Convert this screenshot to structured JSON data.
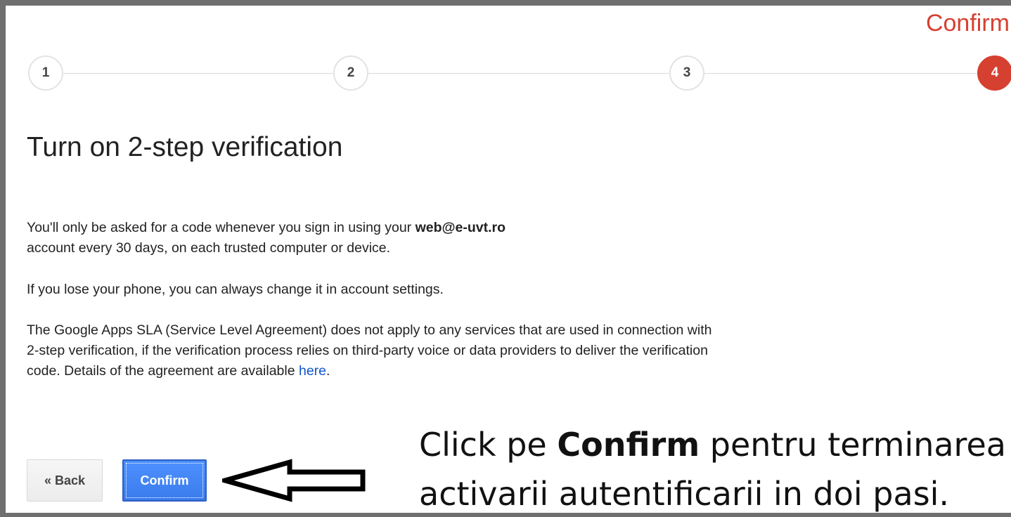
{
  "stepper": {
    "current_label": "Confirm",
    "steps": [
      "1",
      "2",
      "3",
      "4"
    ]
  },
  "page": {
    "title": "Turn on 2-step verification"
  },
  "content": {
    "p1_text": "You'll only be asked for a code whenever you sign in using your ",
    "p1_email": "web@e-uvt.ro",
    "p1_cont": "account every 30 days, on each trusted computer or device.",
    "p2": "If you lose your phone, you can always change it in account settings.",
    "p3_text": "The Google Apps SLA (Service Level Agreement) does not apply to any services that are used in connection with 2-step verification, if the verification process relies on third-party voice or data providers to deliver the verification code. Details of the agreement are available ",
    "p3_link": "here",
    "p3_end": "."
  },
  "buttons": {
    "back_label": "« Back",
    "confirm_label": "Confirm"
  },
  "annotation": {
    "line1_prefix": "Click pe ",
    "line1_bold": "Confirm",
    "line1_suffix": " pentru terminarea",
    "line2": "activarii autentificarii in doi pasi."
  },
  "colors": {
    "accent": "#d64031",
    "primary_button": "#4d90fe",
    "link": "#1155cc"
  }
}
